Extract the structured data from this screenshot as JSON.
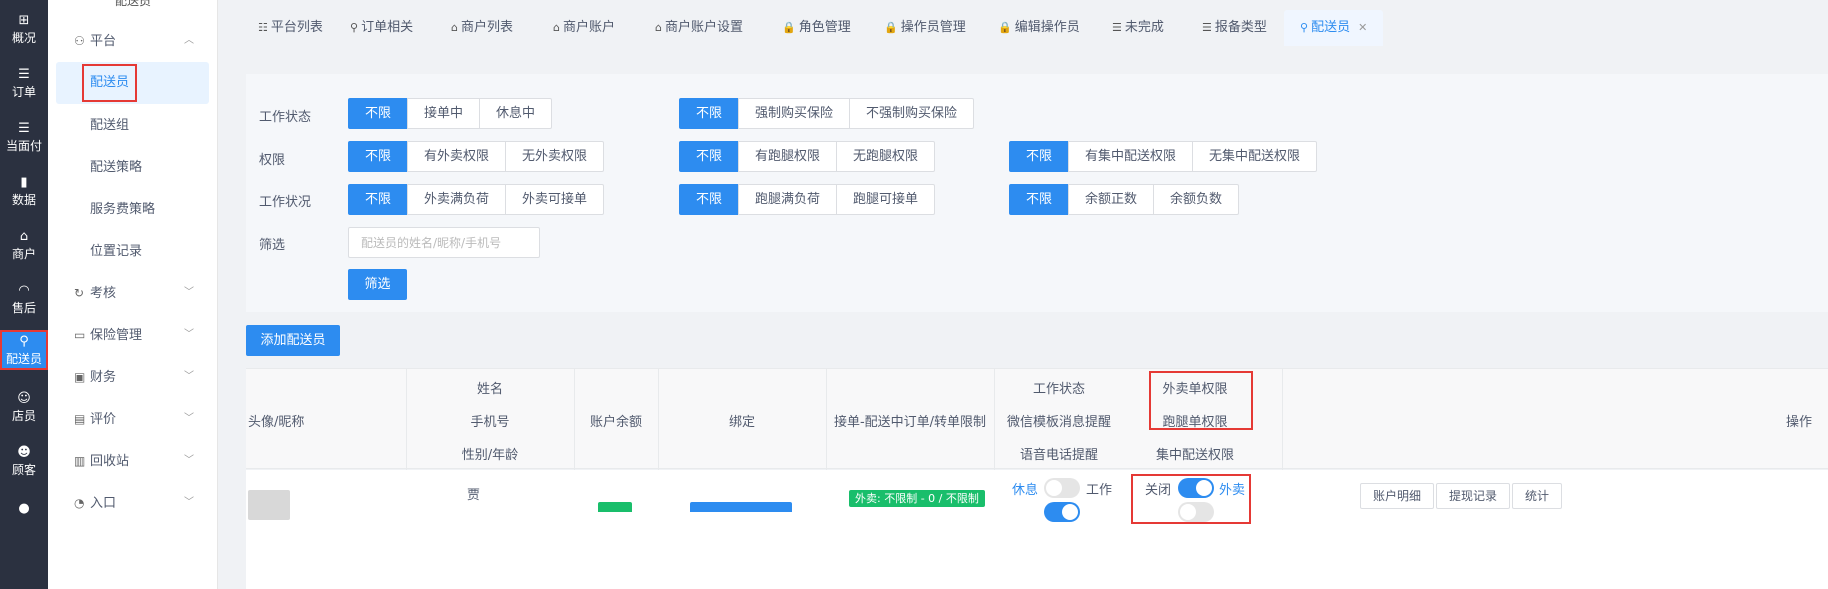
{
  "leftnav": {
    "items": [
      {
        "icon": "⊞",
        "label": "概况"
      },
      {
        "icon": "☰",
        "label": "订单"
      },
      {
        "icon": "☰",
        "label": "当面付"
      },
      {
        "icon": "▮",
        "label": "数据"
      },
      {
        "icon": "⌂",
        "label": "商户"
      },
      {
        "icon": "◠",
        "label": "售后"
      },
      {
        "icon": "⚲",
        "label": "配送员"
      },
      {
        "icon": "☺",
        "label": "店员"
      },
      {
        "icon": "☻",
        "label": "顾客"
      }
    ]
  },
  "sidemenu": {
    "top_cut": "配送员",
    "platform_group": "平台",
    "sub_items": [
      "配送员",
      "配送组",
      "配送策略",
      "服务费策略",
      "位置记录"
    ],
    "groups": [
      "考核",
      "保险管理",
      "财务",
      "评价",
      "回收站",
      "入口"
    ]
  },
  "tabs": [
    {
      "label": "平台列表"
    },
    {
      "label": "订单相关"
    },
    {
      "label": "商户列表"
    },
    {
      "label": "商户账户"
    },
    {
      "label": "商户账户设置"
    },
    {
      "label": "角色管理"
    },
    {
      "label": "操作员管理"
    },
    {
      "label": "编辑操作员"
    },
    {
      "label": "未完成"
    },
    {
      "label": "报备类型"
    },
    {
      "label": "配送员"
    }
  ],
  "filters": {
    "work_status_label": "工作状态",
    "permission_label": "权限",
    "work_condition_label": "工作状况",
    "filter_label": "筛选",
    "work_status": [
      "不限",
      "接单中",
      "休息中"
    ],
    "insurance": [
      "不限",
      "强制购买保险",
      "不强制购买保险"
    ],
    "takeout_perm": [
      "不限",
      "有外卖权限",
      "无外卖权限"
    ],
    "errand_perm": [
      "不限",
      "有跑腿权限",
      "无跑腿权限"
    ],
    "central_perm": [
      "不限",
      "有集中配送权限",
      "无集中配送权限"
    ],
    "takeout_load": [
      "不限",
      "外卖满负荷",
      "外卖可接单"
    ],
    "errand_load": [
      "不限",
      "跑腿满负荷",
      "跑腿可接单"
    ],
    "balance": [
      "不限",
      "余额正数",
      "余额负数"
    ],
    "search_placeholder": "配送员的姓名/昵称/手机号",
    "filter_button": "筛选"
  },
  "add_button": "添加配送员",
  "table": {
    "col_avatar": "头像/昵称",
    "col_name": "姓名",
    "col_phone": "手机号",
    "col_gender_age": "性别/年龄",
    "col_balance": "账户余额",
    "col_bind": "绑定",
    "col_limits": "接单-配送中订单/转单限制",
    "col_work_status": "工作状态",
    "col_wechat": "微信模板消息提醒",
    "col_voice": "语音电话提醒",
    "col_takeout_perm": "外卖单权限",
    "col_errand_perm": "跑腿单权限",
    "col_central_perm": "集中配送权限",
    "col_ops": "操作",
    "row": {
      "name": "贾",
      "limit_tag": "外卖: 不限制 - 0 / 不限制",
      "rest_label": "休息",
      "work_label": "工作",
      "off_label": "关闭",
      "takeout_label": "外卖",
      "ops": [
        "账户明细",
        "提现记录",
        "统计"
      ]
    }
  }
}
